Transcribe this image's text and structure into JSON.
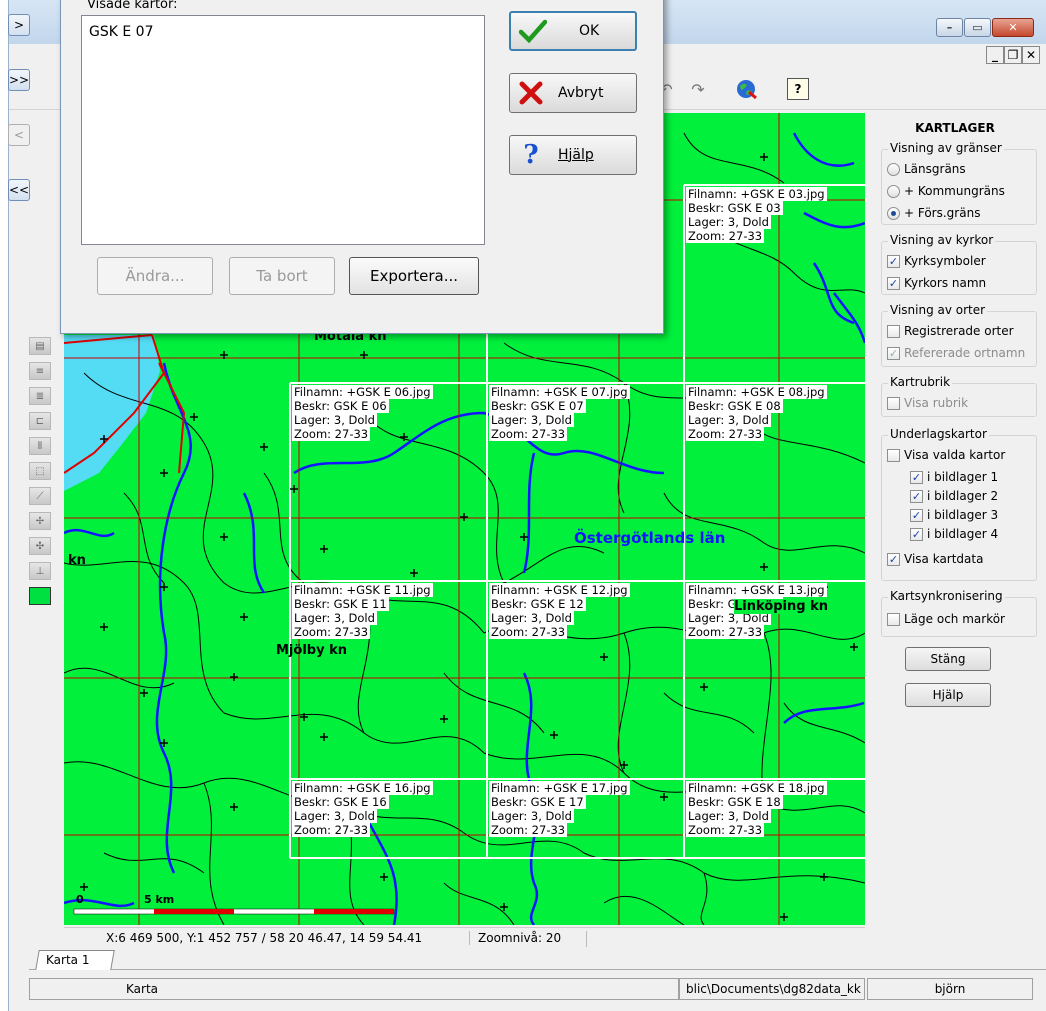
{
  "dialog": {
    "list_label": "Visade kartor:",
    "list_items": [
      "GSK E 07"
    ],
    "ok_label": "OK",
    "cancel_label": "Avbryt",
    "help_label": "Hjälp",
    "edit_label": "Ändra...",
    "remove_label": "Ta bort",
    "export_label": "Exportera...",
    "arrow_buttons": [
      ">",
      ">>",
      "<",
      "<<"
    ]
  },
  "map": {
    "tiles": [
      {
        "id": "03",
        "lines": [
          "Filnamn: +GSK E 03.jpg",
          "Beskr: GSK E 03",
          " Lager: 3, Dold",
          " Zoom: 27-33"
        ]
      },
      {
        "id": "06",
        "lines": [
          "Filnamn: +GSK E 06.jpg",
          "Beskr: GSK E 06",
          " Lager: 3, Dold",
          " Zoom: 27-33"
        ]
      },
      {
        "id": "07",
        "lines": [
          "Filnamn: +GSK E 07.jpg",
          "Beskr: GSK E 07",
          " Lager: 3, Dold",
          " Zoom: 27-33"
        ]
      },
      {
        "id": "08",
        "lines": [
          "Filnamn: +GSK E 08.jpg",
          "Beskr: GSK E 08",
          " Lager: 3, Dold",
          " Zoom: 27-33"
        ]
      },
      {
        "id": "11",
        "lines": [
          "Filnamn: +GSK E 11.jpg",
          "Beskr: GSK E 11",
          " Lager: 3, Dold",
          " Zoom: 27-33"
        ]
      },
      {
        "id": "12",
        "lines": [
          "Filnamn: +GSK E 12.jpg",
          "Beskr: GSK E 12",
          " Lager: 3, Dold",
          " Zoom: 27-33"
        ]
      },
      {
        "id": "13",
        "lines": [
          "Filnamn: +GSK E 13.jpg",
          "Beskr: GSK E 13",
          " Lager: 3, Dold",
          " Zoom: 27-33"
        ]
      },
      {
        "id": "16",
        "lines": [
          "Filnamn: +GSK E 16.jpg",
          "Beskr: GSK E 16",
          " Lager: 3, Dold",
          " Zoom: 27-33"
        ]
      },
      {
        "id": "17",
        "lines": [
          "Filnamn: +GSK E 17.jpg",
          "Beskr: GSK E 17",
          " Lager: 3, Dold",
          " Zoom: 27-33"
        ]
      },
      {
        "id": "18",
        "lines": [
          "Filnamn: +GSK E 18.jpg",
          "Beskr: GSK E 18",
          " Lager: 3, Dold",
          " Zoom: 27-33"
        ]
      }
    ],
    "places": {
      "motala": "Motala kn",
      "lan": "Östergötlands län",
      "linkoping": "Linköping kn",
      "mjolby": "Mjölby kn",
      "kn_left": "kn"
    },
    "scale": {
      "zero": "0",
      "five": "5 km"
    },
    "colors": {
      "land": "#00f03c",
      "water": "#55dcf5",
      "border_blue": "#1414ff",
      "grid_red": "#c80000"
    }
  },
  "coordbar": {
    "coords": "X:6 469 500, Y:1 452 757 / 58 20 46.47, 14 59 54.41",
    "zoom": "Zoomnivå: 20"
  },
  "tabs": [
    "Karta 1"
  ],
  "statusbar": {
    "mode": "Karta",
    "path": "blic\\Documents\\dg82data_kk",
    "user": "björn"
  },
  "panel": {
    "title": "KARTLAGER",
    "boundaries": {
      "title": "Visning av gränser",
      "options": [
        "Länsgräns",
        "+ Kommungräns",
        "+ Förs.gräns"
      ],
      "selected": 2
    },
    "churches": {
      "title": "Visning av kyrkor",
      "symbols": "Kyrksymboler",
      "names": "Kyrkors namn"
    },
    "places": {
      "title": "Visning av orter",
      "registered": "Registrerade orter",
      "referenced": "Refererade ortnamn"
    },
    "heading": {
      "title": "Kartrubrik",
      "show": "Visa rubrik"
    },
    "base_maps": {
      "title": "Underlagskartor",
      "show_selected": "Visa valda kartor",
      "layers": [
        "i bildlager 1",
        "i bildlager 2",
        "i bildlager 3",
        "i bildlager 4"
      ],
      "show_data": "Visa kartdata"
    },
    "sync": {
      "title": "Kartsynkronisering",
      "position": "Läge och markör"
    },
    "close_label": "Stäng",
    "help_label": "Hjälp"
  }
}
